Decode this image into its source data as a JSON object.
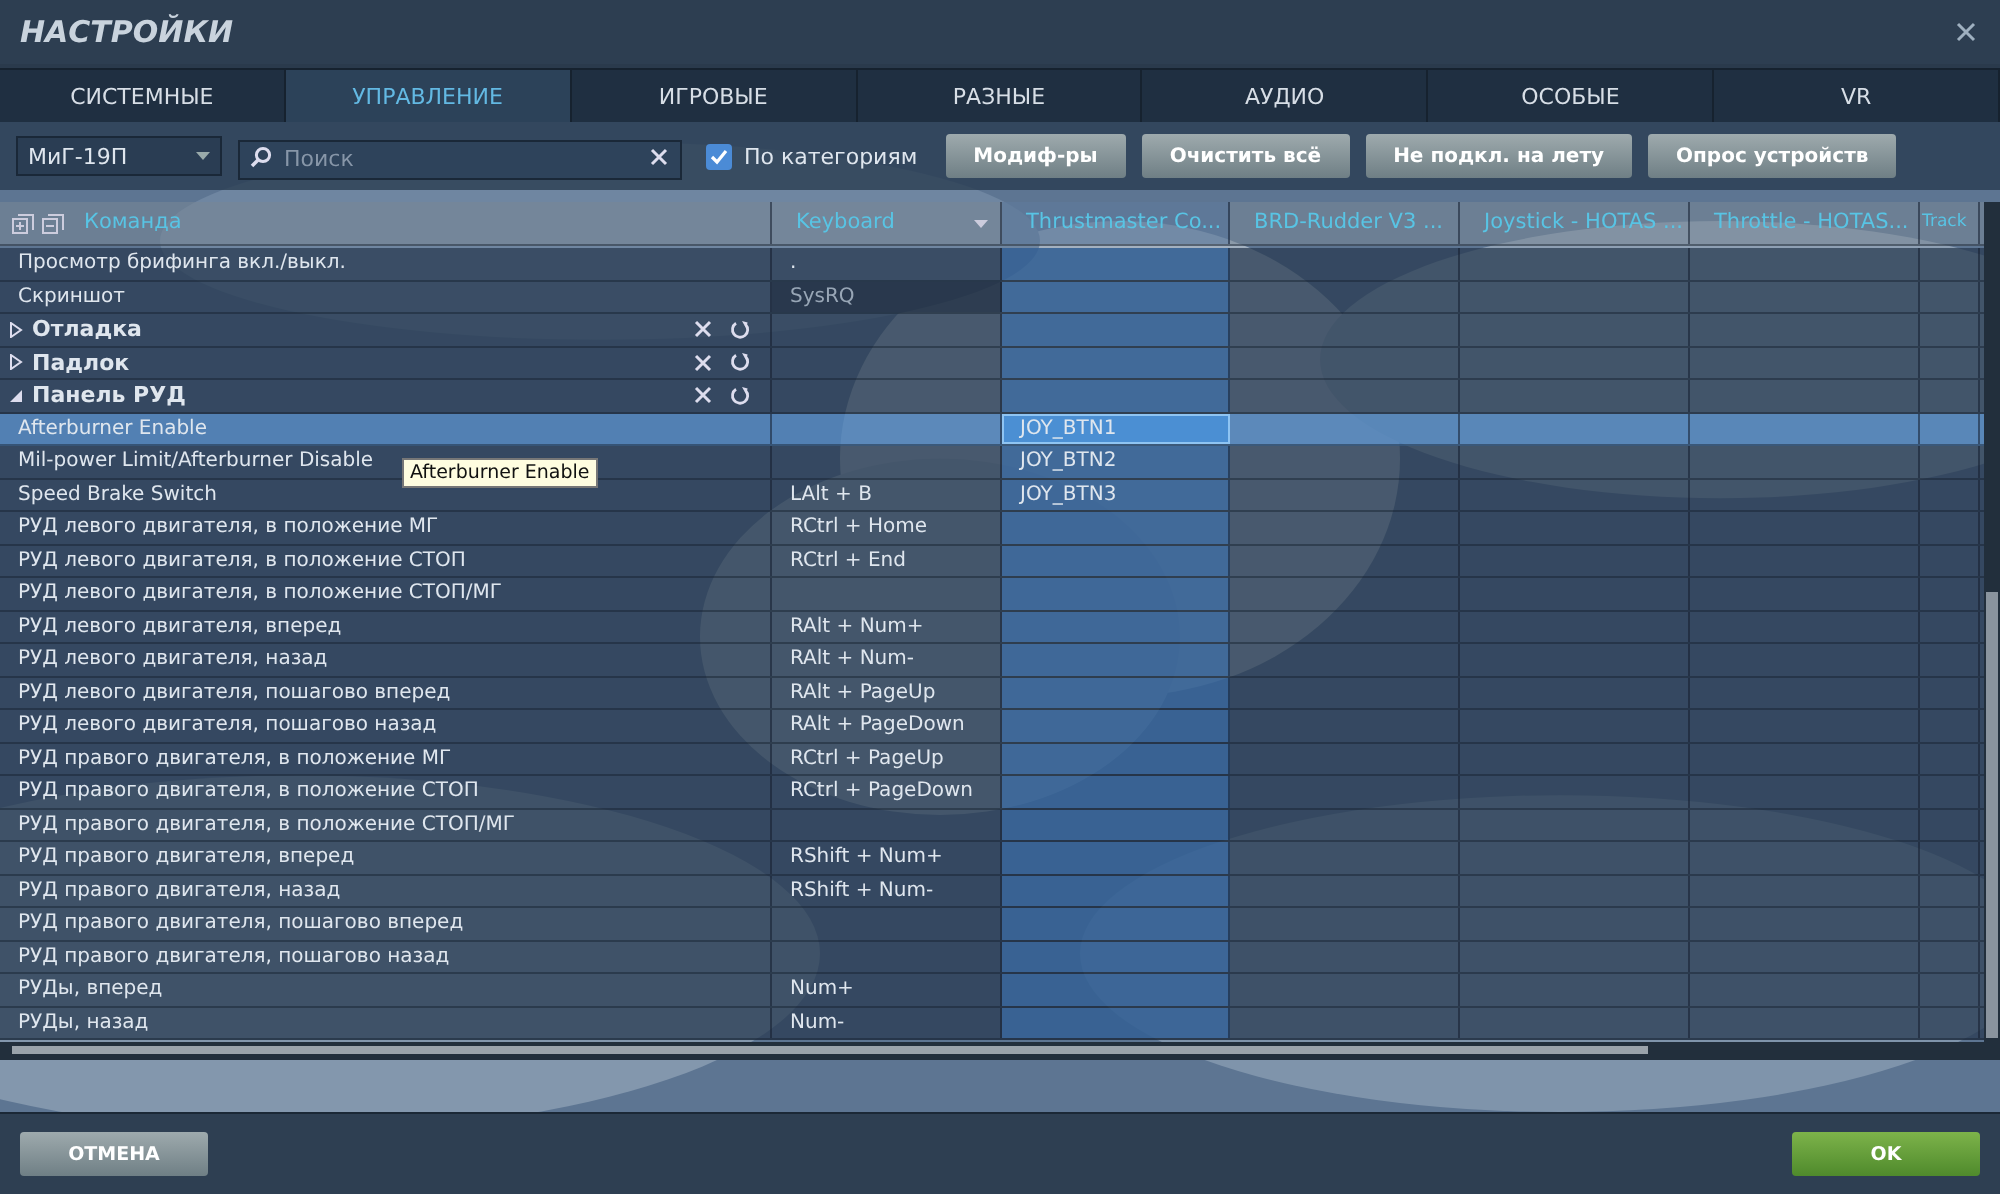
{
  "window": {
    "title": "НАСТРОЙКИ"
  },
  "tabs": [
    {
      "label": "СИСТЕМНЫЕ",
      "selected": false
    },
    {
      "label": "УПРАВЛЕНИЕ",
      "selected": true
    },
    {
      "label": "ИГРОВЫЕ",
      "selected": false
    },
    {
      "label": "РАЗНЫЕ",
      "selected": false
    },
    {
      "label": "АУДИО",
      "selected": false
    },
    {
      "label": "ОСОБЫЕ",
      "selected": false
    },
    {
      "label": "VR",
      "selected": false
    }
  ],
  "toolbar": {
    "aircraft": "МиГ-19П",
    "search": {
      "placeholder": "Поиск"
    },
    "by_category": {
      "label": "По категориям",
      "checked": true
    },
    "buttons": [
      "Модиф-ры",
      "Очистить всё",
      "Не подкл. на лету",
      "Опрос устройств"
    ]
  },
  "table": {
    "columns": [
      {
        "label": "Команда",
        "selected": false
      },
      {
        "label": "Keyboard",
        "selected": false
      },
      {
        "label": "Thrustmaster Co...",
        "selected": true
      },
      {
        "label": "BRD-Rudder V3 ...",
        "selected": false
      },
      {
        "label": "Joystick - HOTAS ...",
        "selected": false
      },
      {
        "label": "Throttle - HOTAS...",
        "selected": false
      },
      {
        "label": "Track",
        "selected": false
      }
    ],
    "rows": [
      {
        "kind": "command",
        "name": "Просмотр брифинга вкл./выкл.",
        "keyboard": ".",
        "keyboard_greyed": false,
        "joystick": "",
        "selected": false
      },
      {
        "kind": "command",
        "name": "Скриншот",
        "keyboard": "SysRQ",
        "keyboard_greyed": true,
        "joystick": "",
        "selected": false
      },
      {
        "kind": "category",
        "name": "Отладка",
        "expanded": false
      },
      {
        "kind": "category",
        "name": "Падлок",
        "expanded": false
      },
      {
        "kind": "category",
        "name": "Панель РУД",
        "expanded": true
      },
      {
        "kind": "command",
        "name": "Afterburner Enable",
        "keyboard": "",
        "keyboard_greyed": false,
        "joystick": "JOY_BTN1",
        "selected": true
      },
      {
        "kind": "command",
        "name": "Mil-power Limit/Afterburner Disable",
        "keyboard": "",
        "keyboard_greyed": false,
        "joystick": "JOY_BTN2",
        "selected": false
      },
      {
        "kind": "command",
        "name": "Speed Brake Switch",
        "keyboard": "LAlt + B",
        "keyboard_greyed": false,
        "joystick": "JOY_BTN3",
        "selected": false
      },
      {
        "kind": "command",
        "name": "РУД левого двигателя, в положение МГ",
        "keyboard": "RCtrl + Home",
        "keyboard_greyed": false,
        "joystick": "",
        "selected": false
      },
      {
        "kind": "command",
        "name": "РУД левого двигателя, в положение СТОП",
        "keyboard": "RCtrl + End",
        "keyboard_greyed": false,
        "joystick": "",
        "selected": false
      },
      {
        "kind": "command",
        "name": "РУД левого двигателя, в положение СТОП/МГ",
        "keyboard": "",
        "keyboard_greyed": false,
        "joystick": "",
        "selected": false
      },
      {
        "kind": "command",
        "name": "РУД левого двигателя, вперед",
        "keyboard": "RAlt + Num+",
        "keyboard_greyed": false,
        "joystick": "",
        "selected": false
      },
      {
        "kind": "command",
        "name": "РУД левого двигателя, назад",
        "keyboard": "RAlt + Num-",
        "keyboard_greyed": false,
        "joystick": "",
        "selected": false
      },
      {
        "kind": "command",
        "name": "РУД левого двигателя, пошагово вперед",
        "keyboard": "RAlt + PageUp",
        "keyboard_greyed": false,
        "joystick": "",
        "selected": false
      },
      {
        "kind": "command",
        "name": "РУД левого двигателя, пошагово назад",
        "keyboard": "RAlt + PageDown",
        "keyboard_greyed": false,
        "joystick": "",
        "selected": false
      },
      {
        "kind": "command",
        "name": "РУД правого двигателя, в положение МГ",
        "keyboard": "RCtrl + PageUp",
        "keyboard_greyed": false,
        "joystick": "",
        "selected": false
      },
      {
        "kind": "command",
        "name": "РУД правого двигателя, в положение СТОП",
        "keyboard": "RCtrl + PageDown",
        "keyboard_greyed": false,
        "joystick": "",
        "selected": false
      },
      {
        "kind": "command",
        "name": "РУД правого двигателя, в положение СТОП/МГ",
        "keyboard": "",
        "keyboard_greyed": false,
        "joystick": "",
        "selected": false
      },
      {
        "kind": "command",
        "name": "РУД правого двигателя, вперед",
        "keyboard": "RShift + Num+",
        "keyboard_greyed": false,
        "joystick": "",
        "selected": false
      },
      {
        "kind": "command",
        "name": "РУД правого двигателя, назад",
        "keyboard": "RShift + Num-",
        "keyboard_greyed": false,
        "joystick": "",
        "selected": false
      },
      {
        "kind": "command",
        "name": "РУД правого двигателя, пошагово вперед",
        "keyboard": "",
        "keyboard_greyed": false,
        "joystick": "",
        "selected": false
      },
      {
        "kind": "command",
        "name": "РУД правого двигателя, пошагово назад",
        "keyboard": "",
        "keyboard_greyed": false,
        "joystick": "",
        "selected": false
      },
      {
        "kind": "command",
        "name": "РУДы, вперед",
        "keyboard": "Num+",
        "keyboard_greyed": false,
        "joystick": "",
        "selected": false
      },
      {
        "kind": "command",
        "name": "РУДы, назад",
        "keyboard": "Num-",
        "keyboard_greyed": false,
        "joystick": "",
        "selected": false
      }
    ]
  },
  "tooltip": "Afterburner Enable",
  "footer": {
    "cancel": "ОТМЕНА",
    "ok": "OK"
  }
}
